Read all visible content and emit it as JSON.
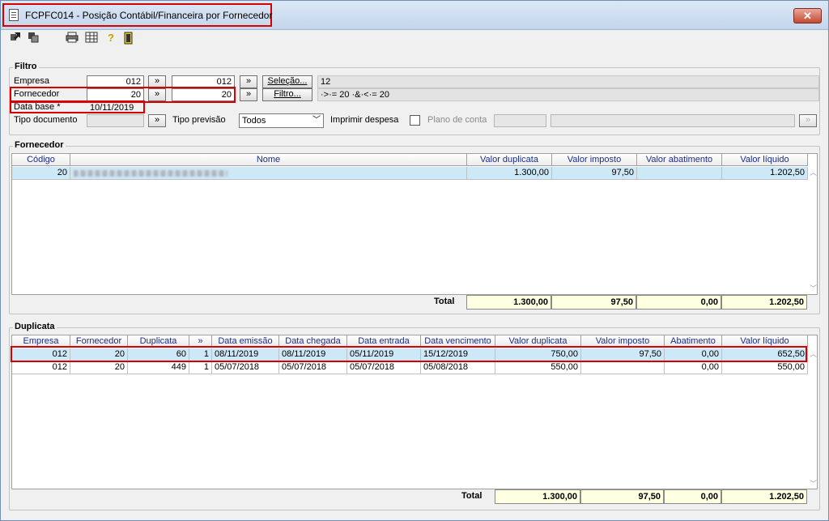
{
  "window": {
    "title": "FCPFC014 - Posição Contábil/Financeira por Fornecedor",
    "close_label": "✕"
  },
  "filtro": {
    "group_label": "Filtro",
    "empresa_label": "Empresa",
    "empresa_from": "012",
    "empresa_to": "012",
    "fornecedor_label": "Fornecedor",
    "fornecedor_from": "20",
    "fornecedor_to": "20",
    "range_btn": "»",
    "selecao_btn": "Seleção...",
    "filtro_btn": "Filtro...",
    "selecao_value": "12",
    "filtro_value": "·>·= 20 ·&·<·= 20",
    "data_base_label": "Data base *",
    "data_base_value": "10/11/2019",
    "tipo_documento_label": "Tipo documento",
    "tipo_previsao_label": "Tipo previsão",
    "tipo_previsao_value": "Todos",
    "imprimir_despesa_label": "Imprimir despesa",
    "plano_conta_label": "Plano de conta",
    "plano_btn": "»"
  },
  "fornecedor": {
    "group_label": "Fornecedor",
    "headers": [
      "Código",
      "Nome",
      "Valor duplicata",
      "Valor imposto",
      "Valor abatimento",
      "Valor líquido"
    ],
    "rows": [
      {
        "codigo": "20",
        "valor_duplicata": "1.300,00",
        "valor_imposto": "97,50",
        "valor_abatimento": "",
        "valor_liquido": "1.202,50"
      }
    ],
    "total_label": "Total",
    "totals": [
      "1.300,00",
      "97,50",
      "0,00",
      "1.202,50"
    ]
  },
  "duplicata": {
    "group_label": "Duplicata",
    "headers": [
      "Empresa",
      "Fornecedor",
      "Duplicata",
      "»",
      "Data emissão",
      "Data chegada",
      "Data entrada",
      "Data vencimento",
      "Valor duplicata",
      "Valor imposto",
      "Abatimento",
      "Valor líquido"
    ],
    "rows": [
      [
        "012",
        "20",
        "60",
        "1",
        "08/11/2019",
        "08/11/2019",
        "05/11/2019",
        "15/12/2019",
        "750,00",
        "97,50",
        "0,00",
        "652,50"
      ],
      [
        "012",
        "20",
        "449",
        "1",
        "05/07/2018",
        "05/07/2018",
        "05/07/2018",
        "05/08/2018",
        "550,00",
        "",
        "0,00",
        "550,00"
      ]
    ],
    "total_label": "Total",
    "totals": [
      "1.300,00",
      "97,50",
      "0,00",
      "1.202,50"
    ]
  }
}
